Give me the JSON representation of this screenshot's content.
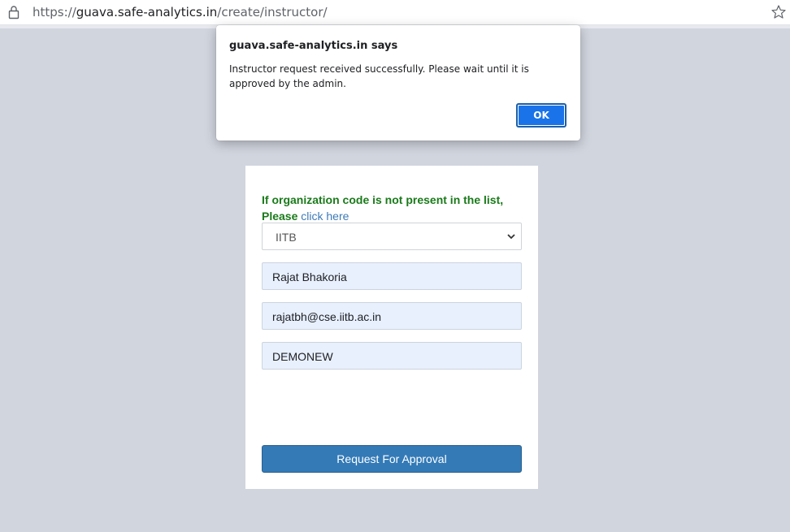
{
  "browser": {
    "url_scheme": "https://",
    "url_host": "guava.safe-analytics.in",
    "url_path": "/create/instructor/"
  },
  "dialog": {
    "title": "guava.safe-analytics.in says",
    "message": "Instructor request received successfully. Please wait until it is approved by the admin.",
    "ok_label": "OK"
  },
  "form": {
    "notice_text": "If organization code is not present in the list, Please",
    "notice_link": "click here",
    "organization_selected": "IITB",
    "name_value": "Rajat Bhakoria",
    "email_value": "rajatbh@cse.iitb.ac.in",
    "code_value": "DEMONEW",
    "submit_label": "Request For Approval"
  },
  "colors": {
    "page_background": "#d1d5de",
    "notice_green": "#1a7a1a",
    "link_blue": "#3d7ab8",
    "autofill_blue": "#e8f0fe",
    "submit_blue": "#337ab7",
    "dialog_ok_blue": "#1a73e8"
  },
  "icons": {
    "lock": "lock-icon",
    "star": "bookmark-star-icon",
    "select_arrow": "chevron-down-icon"
  }
}
